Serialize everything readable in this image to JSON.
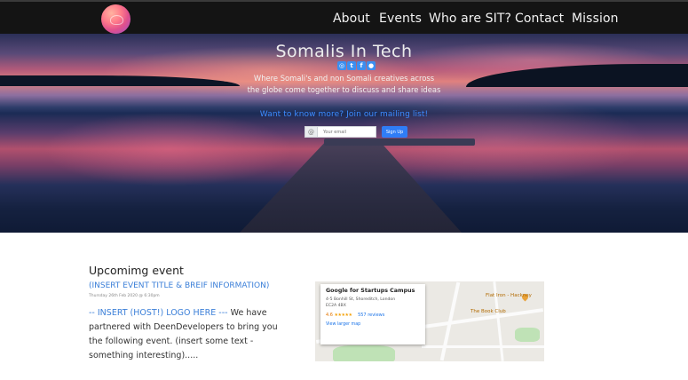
{
  "nav": {
    "items": [
      "About",
      "Events",
      "Who are SIT?",
      "Contact",
      "Mission"
    ]
  },
  "hero": {
    "title": "Somalis In Tech",
    "social_icons": [
      "instagram-icon",
      "twitter-icon",
      "facebook-icon",
      "github-icon"
    ],
    "tagline_line1": "Where Somali's and non Somali creatives across",
    "tagline_line2": "the globe come together to discuss and share ideas",
    "mailing_prompt": "Want to know more? Join our mailing list!",
    "email_prefix": "@",
    "email_placeholder": "Your email",
    "signup_label": "Sign Up"
  },
  "event": {
    "heading": "Upcomimg event",
    "info": "(INSERT EVENT TITLE & BREIF INFORMATION)",
    "date": "Thursday 26th Feb 2020 @ 6:30pm",
    "host": "-- INSERT (HOST!) LOGO HERE ---",
    "body": " We have partnered with DeenDevelopers to bring you the following event. (insert some text - something interesting)....."
  },
  "map": {
    "place_name": "Google for Startups Campus",
    "address_line1": "4-5 Bonhill St, Shoreditch, London",
    "address_line2": "EC2A 4BX",
    "rating": "4.6",
    "stars": "★★★★★",
    "reviews": "557 reviews",
    "larger_map": "View larger map",
    "label_flat_iron": "Flat Iron - Hackney",
    "label_book_club": "The Book Club"
  },
  "colors": {
    "navbar_bg": "#141414",
    "accent_blue": "#3b7fd8",
    "signup_button": "#2f7df6"
  }
}
